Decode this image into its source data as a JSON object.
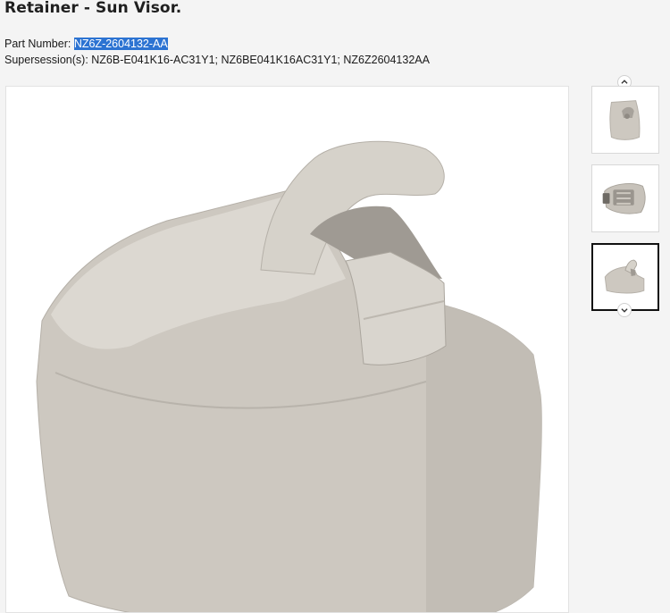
{
  "product": {
    "title": "Retainer - Sun Visor.",
    "part_number_label": "Part Number: ",
    "part_number": "NZ6Z-2604132-AA",
    "supersession_label": "Supersession(s): ",
    "supersessions": "NZ6B-E041K16-AC31Y1; NZ6BE041K16AC31Y1; NZ6Z2604132AA"
  },
  "gallery": {
    "main_image": "sun-visor-retainer-photo",
    "thumbnails": [
      {
        "name": "retainer-front-view",
        "active": false
      },
      {
        "name": "retainer-underside-view",
        "active": false
      },
      {
        "name": "retainer-angled-view",
        "active": true
      }
    ],
    "icons": {
      "up": "chevron-up-icon",
      "down": "chevron-down-icon"
    }
  },
  "colors": {
    "selection": "#2c73d2",
    "part_body": "#cfcac2",
    "active_border": "#111111"
  }
}
